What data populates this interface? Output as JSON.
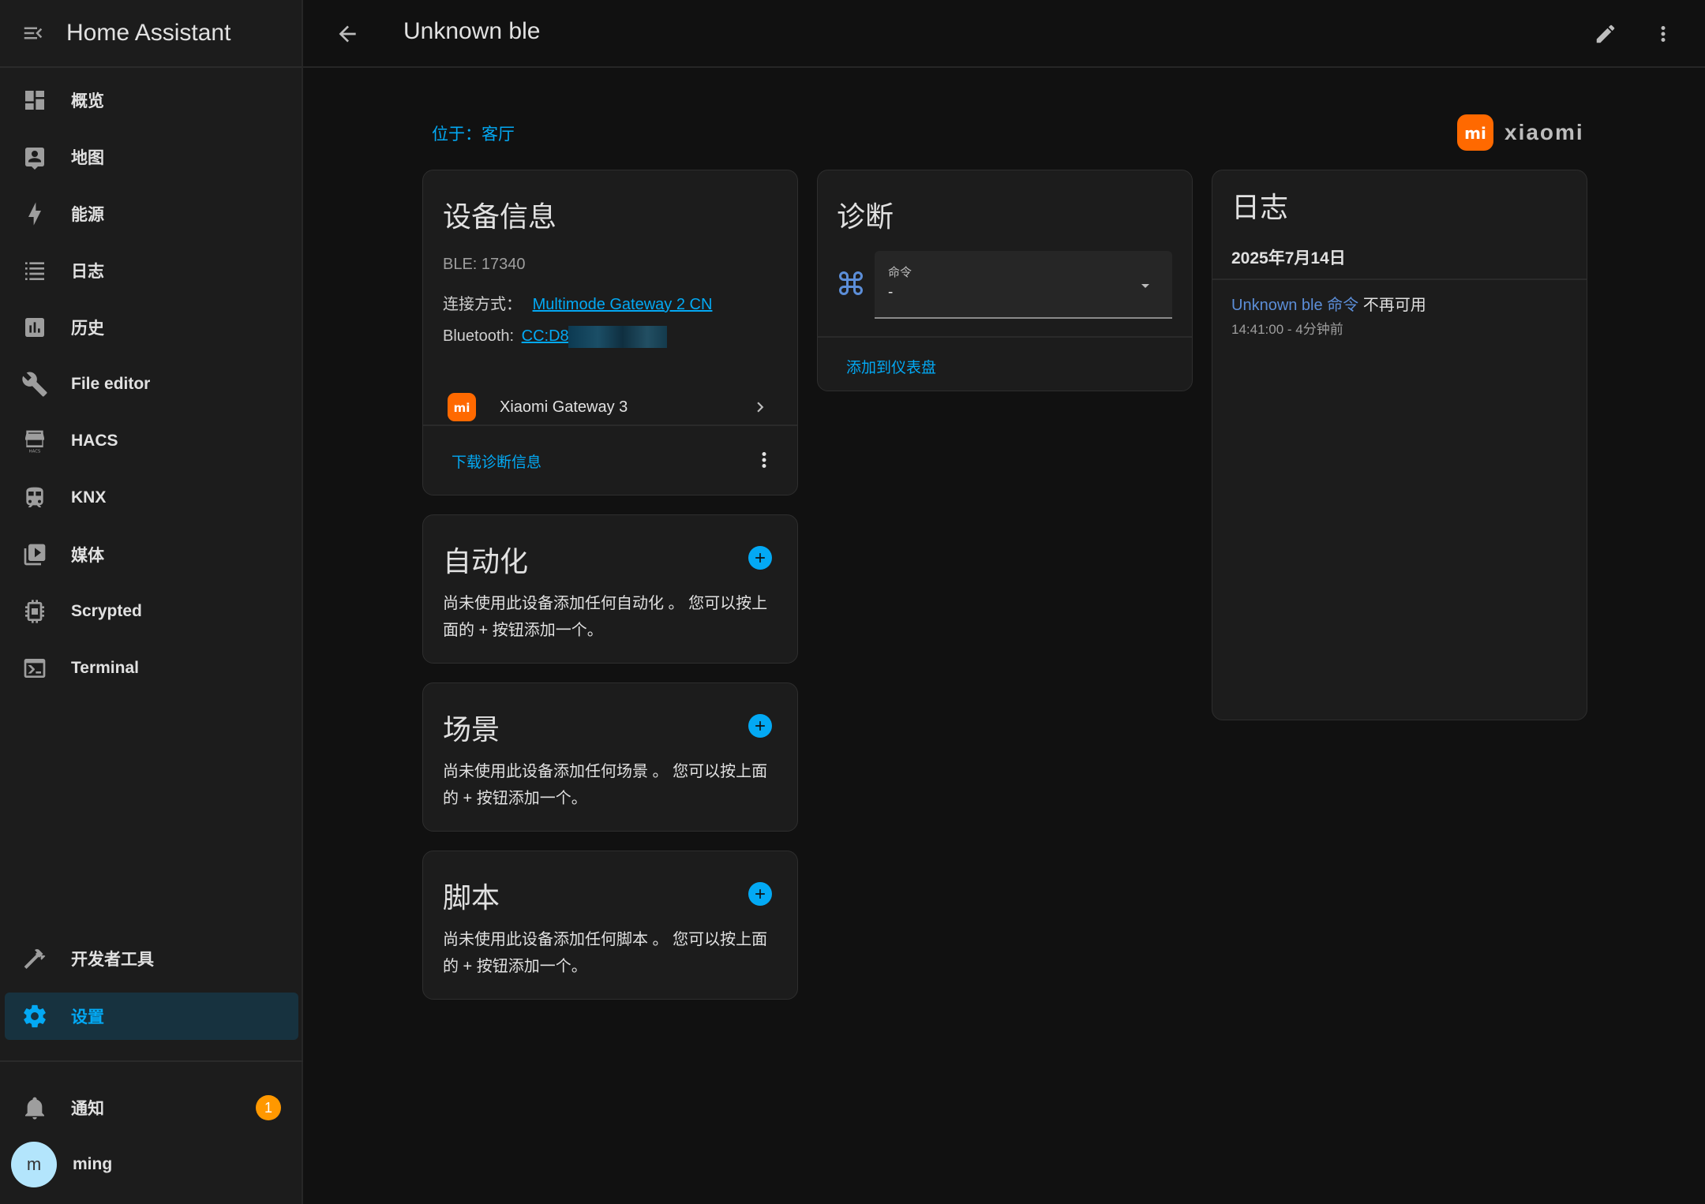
{
  "sidebar": {
    "title": "Home Assistant",
    "items": [
      {
        "label": "概览",
        "icon": "dashboard-icon"
      },
      {
        "label": "地图",
        "icon": "map-icon"
      },
      {
        "label": "能源",
        "icon": "lightning-icon"
      },
      {
        "label": "日志",
        "icon": "logbook-list-icon"
      },
      {
        "label": "历史",
        "icon": "history-chart-icon"
      },
      {
        "label": "File editor",
        "icon": "wrench-icon"
      },
      {
        "label": "HACS",
        "icon": "hacs-store-icon"
      },
      {
        "label": "KNX",
        "icon": "knx-train-icon"
      },
      {
        "label": "媒体",
        "icon": "media-play-icon"
      },
      {
        "label": "Scrypted",
        "icon": "chip-icon"
      },
      {
        "label": "Terminal",
        "icon": "terminal-icon"
      }
    ],
    "bottom_items": [
      {
        "label": "开发者工具",
        "icon": "hammer-icon"
      },
      {
        "label": "设置",
        "icon": "gear-icon",
        "active": true
      }
    ],
    "notifications": {
      "label": "通知",
      "count": "1"
    },
    "user": {
      "initial": "m",
      "name": "ming"
    }
  },
  "header": {
    "title": "Unknown ble"
  },
  "area": {
    "text": "位于：客厅"
  },
  "brand": {
    "badge": "mi",
    "text": "xiaomi"
  },
  "device_info": {
    "title": "设备信息",
    "ble": "BLE: 17340",
    "connection_label": "连接方式：",
    "connection_value": "Multimode Gateway 2 CN",
    "bluetooth_label": "Bluetooth:",
    "bluetooth_value": "CC:D8:",
    "via_device_badge": "mi",
    "via_device": "Xiaomi Gateway 3",
    "download_diagnostics": "下载诊断信息"
  },
  "automation": {
    "title": "自动化",
    "description": "尚未使用此设备添加任何自动化 。 您可以按上面的 + 按钮添加一个。"
  },
  "scene": {
    "title": "场景",
    "description": "尚未使用此设备添加任何场景 。 您可以按上面的 + 按钮添加一个。"
  },
  "script": {
    "title": "脚本",
    "description": "尚未使用此设备添加任何脚本 。 您可以按上面的 + 按钮添加一个。"
  },
  "diagnostics": {
    "title": "诊断",
    "select_label": "命令",
    "select_value": "-",
    "add_to_dashboard": "添加到仪表盘"
  },
  "logbook": {
    "title": "日志",
    "date": "2025年7月14日",
    "entry_entity": "Unknown ble 命令",
    "entry_state": " 不再可用",
    "entry_time": "14:41:00 - 4分钟前"
  },
  "colors": {
    "accent": "#03a9f4",
    "badge": "#ff9800",
    "xiaomi": "#ff6900",
    "background": "#111111",
    "card": "#1c1c1c"
  }
}
